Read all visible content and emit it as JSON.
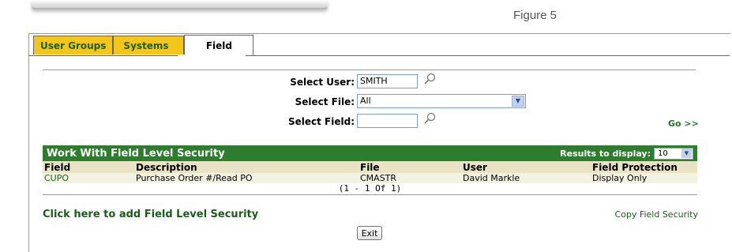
{
  "caption": "Figure 5",
  "tabs": [
    {
      "label": "User Groups"
    },
    {
      "label": "Systems"
    },
    {
      "label": "Field"
    }
  ],
  "filters": {
    "user_label": "Select User:",
    "user_value": "SMITH",
    "file_label": "Select File:",
    "file_value": "All",
    "field_label": "Select Field:",
    "field_value": "",
    "go_label": "Go >>"
  },
  "grid": {
    "title": "Work With Field Level Security",
    "results_label": "Results to display:",
    "results_value": "10",
    "columns": [
      "Field",
      "Description",
      "File",
      "User",
      "Field Protection"
    ],
    "rows": [
      [
        "CUPO",
        "Purchase Order #/Read PO",
        "CMASTR",
        "David Markle",
        "Display Only"
      ]
    ],
    "pager": "(1 - 1 Of 1)"
  },
  "actions": {
    "add_label": "Click here to add Field Level Security",
    "copy_label": "Copy Field Security",
    "exit_label": "Exit"
  },
  "colors": {
    "header_green": "#2e7d2e",
    "tab_yellow": "#f5c61a",
    "link_green": "#1a5c1a"
  }
}
